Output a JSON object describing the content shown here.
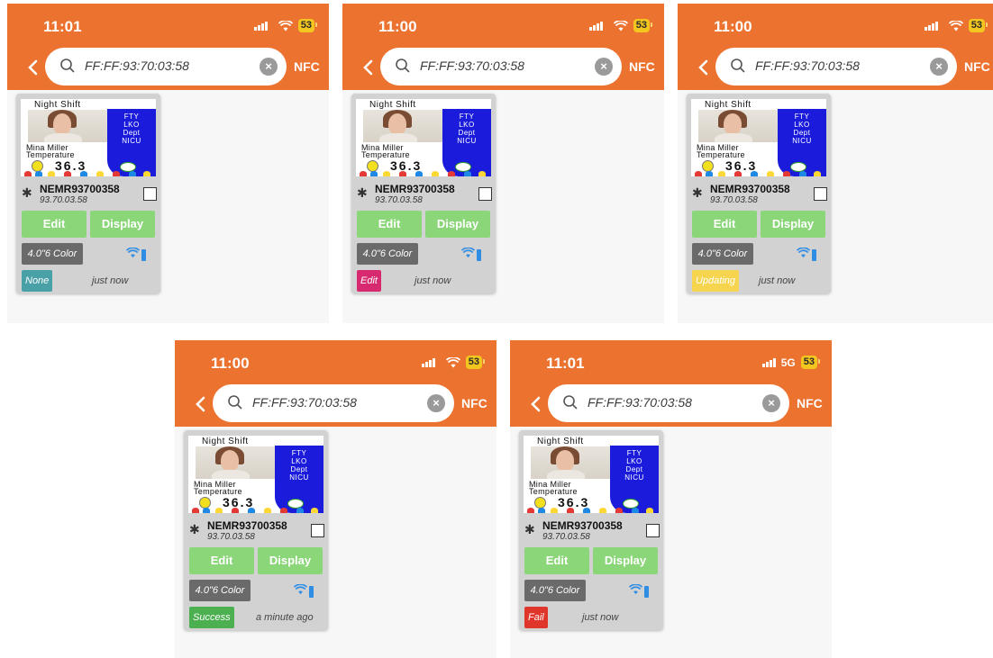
{
  "colors": {
    "header": "#ec722f",
    "button": "#8cd67a",
    "status_none": "#4aa0a7",
    "status_edit": "#d6296f",
    "status_updating": "#f6d44e",
    "status_success": "#4caf50",
    "status_fail": "#e0352b"
  },
  "icons": {
    "back": "chevron-left-icon",
    "search": "search-icon",
    "clear": "clear-icon",
    "bluetooth": "bluetooth-icon",
    "wifi": "wifi-icon",
    "battery": "battery-icon"
  },
  "screens": [
    {
      "time": "11:01",
      "network": "",
      "battery": "53",
      "search": "FF:FF:93:70:03:58",
      "nfc": "NFC",
      "tag": {
        "header": "Night Shift",
        "lines": [
          "FTY",
          "LKO",
          "Dept",
          "NICU"
        ],
        "name": "Mina Miller",
        "label": "Temperature",
        "temp": "36.3"
      },
      "device": {
        "id": "NEMR93700358",
        "mac": "93.70.03.58"
      },
      "edit": "Edit",
      "display": "Display",
      "size": "4.0\"6 Color",
      "status": "None",
      "time_ago": "just now"
    },
    {
      "time": "11:00",
      "network": "",
      "battery": "53",
      "search": "FF:FF:93:70:03:58",
      "nfc": "NFC",
      "tag": {
        "header": "Night Shift",
        "lines": [
          "FTY",
          "LKO",
          "Dept",
          "NICU"
        ],
        "name": "Mina Miller",
        "label": "Temperature",
        "temp": "36.3"
      },
      "device": {
        "id": "NEMR93700358",
        "mac": "93.70.03.58"
      },
      "edit": "Edit",
      "display": "Display",
      "size": "4.0\"6 Color",
      "status": "Edit",
      "time_ago": "just now"
    },
    {
      "time": "11:00",
      "network": "",
      "battery": "53",
      "search": "FF:FF:93:70:03:58",
      "nfc": "NFC",
      "tag": {
        "header": "Night Shift",
        "lines": [
          "FTY",
          "LKO",
          "Dept",
          "NICU"
        ],
        "name": "Mina Miller",
        "label": "Temperature",
        "temp": "36.3"
      },
      "device": {
        "id": "NEMR93700358",
        "mac": "93.70.03.58"
      },
      "edit": "Edit",
      "display": "Display",
      "size": "4.0\"6 Color",
      "status": "Updating",
      "time_ago": "just now"
    },
    {
      "time": "11:00",
      "network": "",
      "battery": "53",
      "search": "FF:FF:93:70:03:58",
      "nfc": "NFC",
      "tag": {
        "header": "Night Shift",
        "lines": [
          "FTY",
          "LKO",
          "Dept",
          "NICU"
        ],
        "name": "Mina Miller",
        "label": "Temperature",
        "temp": "36.3"
      },
      "device": {
        "id": "NEMR93700358",
        "mac": "93.70.03.58"
      },
      "edit": "Edit",
      "display": "Display",
      "size": "4.0\"6 Color",
      "status": "Success",
      "time_ago": "a minute ago"
    },
    {
      "time": "11:01",
      "network": "5G",
      "battery": "53",
      "search": "FF:FF:93:70:03:58",
      "nfc": "NFC",
      "tag": {
        "header": "Night Shift",
        "lines": [
          "FTY",
          "LKO",
          "Dept",
          "NICU"
        ],
        "name": "Mina Miller",
        "label": "Temperature",
        "temp": "36.3"
      },
      "device": {
        "id": "NEMR93700358",
        "mac": "93.70.03.58"
      },
      "edit": "Edit",
      "display": "Display",
      "size": "4.0\"6 Color",
      "status": "Fail",
      "time_ago": "just now"
    }
  ]
}
